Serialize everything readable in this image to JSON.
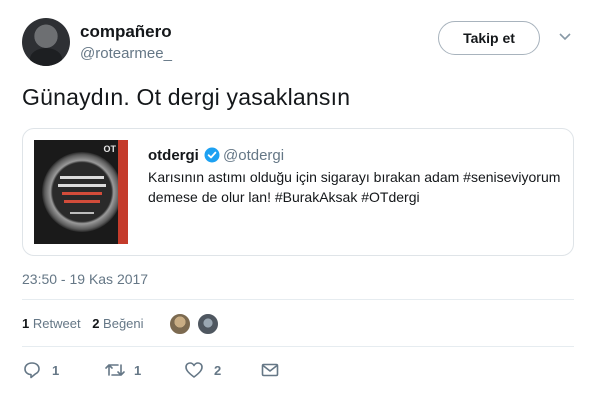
{
  "author": {
    "name": "compañero",
    "handle": "@rotearmee_",
    "follow_label": "Takip et"
  },
  "tweet": {
    "text": "Günaydın. Ot dergi yasaklansın",
    "timestamp": "23:50 - 19 Kas 2017"
  },
  "quoted": {
    "name": "otdergi",
    "handle": "@otdergi",
    "text_line1": "Karısının astımı olduğu için sigarayı bırakan adam #seniseviyorum",
    "text_line2": "demese de olur lan! #BurakAksak #OTdergi",
    "thumb_label": "OT"
  },
  "stats": {
    "retweets_count": "1",
    "retweets_label": "Retweet",
    "likes_count": "2",
    "likes_label": "Beğeni"
  },
  "actions": {
    "reply_count": "1",
    "retweet_count": "1",
    "like_count": "2"
  },
  "colors": {
    "text": "#14171a",
    "secondary": "#657786",
    "verified": "#1da1f2",
    "border": "#e6ecf0"
  },
  "icons": [
    "avatar",
    "chevron-down-icon",
    "verified-icon",
    "reply-icon",
    "retweet-icon",
    "heart-icon",
    "mail-icon"
  ]
}
